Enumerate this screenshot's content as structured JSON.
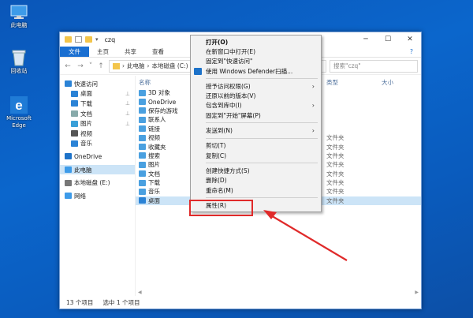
{
  "desktop": {
    "icons": [
      {
        "label": "此电脑",
        "icon": "computer-icon"
      },
      {
        "label": "回收站",
        "icon": "recycle-bin-icon"
      },
      {
        "label": "Microsoft Edge",
        "icon": "edge-icon"
      }
    ]
  },
  "window": {
    "title": "czq",
    "ribbon": [
      "文件",
      "主页",
      "共享",
      "查看"
    ],
    "address": [
      "此电脑",
      "本地磁盘 (C:)"
    ],
    "search_placeholder": "搜索\"czq\"",
    "columns": {
      "name": "名称",
      "type": "类型",
      "size": "大小"
    },
    "sidebar": [
      {
        "label": "快速访问",
        "top": true,
        "icon": "star-icon"
      },
      {
        "label": "桌面",
        "pin": true,
        "icon": "desktop-icon"
      },
      {
        "label": "下载",
        "pin": true,
        "icon": "download-icon"
      },
      {
        "label": "文档",
        "pin": true,
        "icon": "document-icon"
      },
      {
        "label": "图片",
        "pin": true,
        "icon": "picture-icon"
      },
      {
        "label": "视频",
        "icon": "video-icon"
      },
      {
        "label": "音乐",
        "icon": "music-icon"
      },
      {
        "label": "OneDrive",
        "top": true,
        "icon": "cloud-icon"
      },
      {
        "label": "此电脑",
        "top": true,
        "selected": true,
        "icon": "computer-icon"
      },
      {
        "label": "本地磁盘 (E:)",
        "top": true,
        "icon": "drive-icon"
      },
      {
        "label": "网络",
        "top": true,
        "icon": "network-icon"
      }
    ],
    "files": [
      {
        "name": "3D 对象",
        "type": ""
      },
      {
        "name": "OneDrive",
        "type": ""
      },
      {
        "name": "保存的游戏",
        "type": ""
      },
      {
        "name": "联系人",
        "type": ""
      },
      {
        "name": "链接",
        "type": ""
      },
      {
        "name": "视频",
        "type": "文件夹"
      },
      {
        "name": "收藏夹",
        "type": "文件夹"
      },
      {
        "name": "搜索",
        "type": "文件夹"
      },
      {
        "name": "图片",
        "type": "文件夹"
      },
      {
        "name": "文档",
        "type": "文件夹"
      },
      {
        "name": "下载",
        "type": "文件夹"
      },
      {
        "name": "音乐",
        "type": "文件夹"
      },
      {
        "name": "桌面",
        "type": "文件夹",
        "selected": true
      }
    ],
    "folder_types": [
      "文件夹",
      "文件夹",
      "文件夹",
      "文件夹",
      "文件夹"
    ],
    "status": {
      "count": "13 个项目",
      "selected": "选中 1 个项目"
    }
  },
  "context_menu": {
    "items": [
      {
        "label": "打开(O)",
        "bold": true
      },
      {
        "label": "在新窗口中打开(E)"
      },
      {
        "label": "固定到\"快速访问\""
      },
      {
        "label": "使用 Windows Defender扫描...",
        "icon": true
      },
      {
        "sep": true
      },
      {
        "label": "授予访问权限(G)",
        "arrow": true
      },
      {
        "label": "还原以前的版本(V)"
      },
      {
        "label": "包含到库中(I)",
        "arrow": true
      },
      {
        "label": "固定到\"开始\"屏幕(P)"
      },
      {
        "sep": true
      },
      {
        "label": "发送到(N)",
        "arrow": true
      },
      {
        "sep": true
      },
      {
        "label": "剪切(T)"
      },
      {
        "label": "复制(C)"
      },
      {
        "sep": true
      },
      {
        "label": "创建快捷方式(S)"
      },
      {
        "label": "删除(D)"
      },
      {
        "label": "重命名(M)"
      },
      {
        "sep": true
      },
      {
        "label": "属性(R)",
        "highlighted": true
      }
    ]
  },
  "colors": {
    "accent": "#1a6fd1",
    "highlight": "#e02a2a",
    "selection": "#cce4f7",
    "desktop": "#0b66cc"
  }
}
